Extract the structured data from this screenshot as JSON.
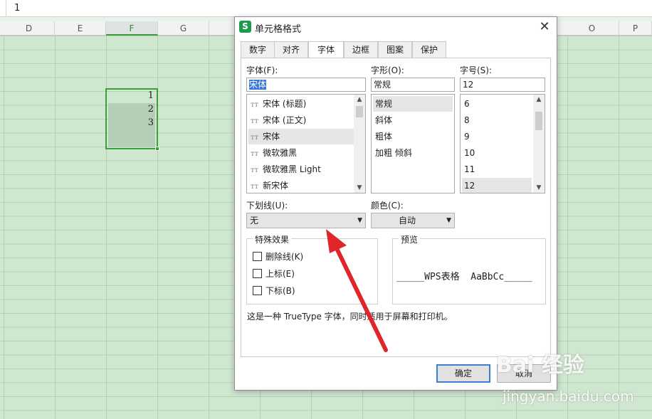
{
  "formula_bar": {
    "value": "1"
  },
  "columns": [
    {
      "label": "D",
      "active": false
    },
    {
      "label": "E",
      "active": false
    },
    {
      "label": "F",
      "active": true
    },
    {
      "label": "G",
      "active": false
    },
    {
      "label": "O",
      "active": false
    },
    {
      "label": "P",
      "active": false
    }
  ],
  "cells": [
    "1",
    "2",
    "3"
  ],
  "dialog": {
    "title": "单元格格式",
    "tabs": [
      "数字",
      "对齐",
      "字体",
      "边框",
      "图案",
      "保护"
    ],
    "active_tab": "字体",
    "font_label": "字体(F):",
    "font_value": "宋体",
    "font_list": [
      "宋体 (标题)",
      "宋体 (正文)",
      "宋体",
      "微软雅黑",
      "微软雅黑 Light",
      "新宋体"
    ],
    "font_icon": "truetype-icon",
    "style_label": "字形(O):",
    "style_value": "常规",
    "style_list": [
      "常规",
      "斜体",
      "粗体",
      "加粗 倾斜"
    ],
    "size_label": "字号(S):",
    "size_value": "12",
    "size_list": [
      "6",
      "8",
      "9",
      "10",
      "11",
      "12"
    ],
    "underline_label": "下划线(U):",
    "underline_value": "无",
    "color_label": "颜色(C):",
    "color_value": "自动",
    "effects_title": "特殊效果",
    "effects": [
      "删除线(K)",
      "上标(E)",
      "下标(B)"
    ],
    "preview_title": "预览",
    "preview_text": "_____WPS表格  AaBbCc_____",
    "description": "这是一种 TrueType 字体，同时适用于屏幕和打印机。",
    "ok_label": "确定",
    "cancel_label": "取消"
  },
  "watermark": {
    "brand": "Bai 经验",
    "url": "jingyan.baidu.com"
  },
  "colors": {
    "selection": "#3aa03a",
    "accent": "#3c7fd0",
    "arrow": "#e0262b"
  }
}
